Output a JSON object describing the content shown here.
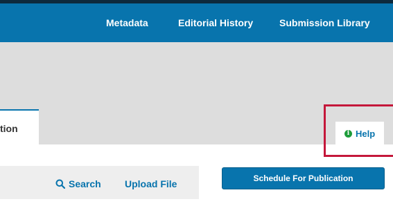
{
  "nav": {
    "links": [
      "Metadata",
      "Editorial History",
      "Submission Library"
    ]
  },
  "tabs": {
    "active_label_partial": "tion",
    "help_label": "Help"
  },
  "filebar": {
    "search_label": "Search",
    "upload_label": "Upload File"
  },
  "actions": {
    "schedule_label": "Schedule For Publication"
  },
  "colors": {
    "brand": "#0874ad",
    "highlight": "#c4173a",
    "info_icon": "#1e9c3a"
  },
  "icons": {
    "help": "info-icon",
    "search": "search-icon"
  }
}
